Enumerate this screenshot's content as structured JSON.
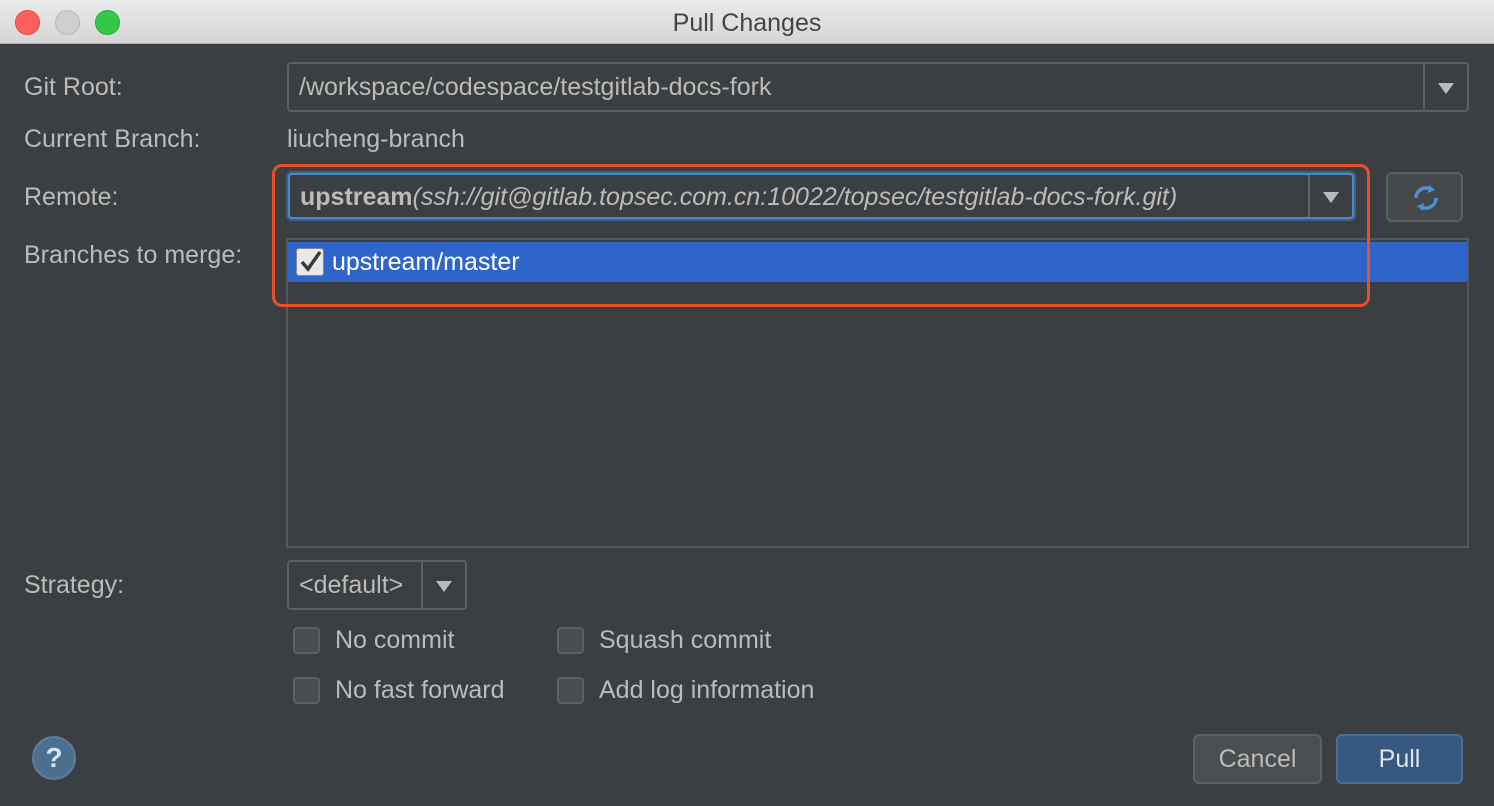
{
  "window": {
    "title": "Pull Changes"
  },
  "form": {
    "git_root_label": "Git Root:",
    "git_root_value": "/workspace/codespace/testgitlab-docs-fork",
    "current_branch_label": "Current Branch:",
    "current_branch_value": "liucheng-branch",
    "remote_label": "Remote:",
    "remote_name": "upstream",
    "remote_url": "(ssh://git@gitlab.topsec.com.cn:10022/topsec/testgitlab-docs-fork.git)",
    "branches_label": "Branches to merge:",
    "branches": [
      {
        "label": "upstream/master",
        "checked": true,
        "selected": true
      }
    ],
    "strategy_label": "Strategy:",
    "strategy_value": "<default>"
  },
  "options": {
    "no_commit": "No commit",
    "squash_commit": "Squash commit",
    "no_fast_forward": "No fast forward",
    "add_log_information": "Add log information"
  },
  "buttons": {
    "help": "?",
    "cancel": "Cancel",
    "pull": "Pull"
  },
  "icons": {
    "refresh": "refresh-icon",
    "dropdown": "triangle-down-icon",
    "check": "checkmark-icon"
  },
  "colors": {
    "accent": "#2f65ca",
    "annotation": "#e8502b",
    "focus": "#4a88c7"
  }
}
